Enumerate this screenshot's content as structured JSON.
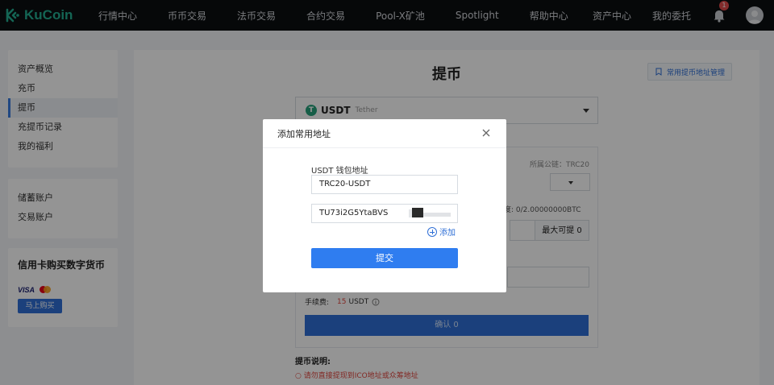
{
  "brand": {
    "name": "KuCoin",
    "color": "#23af91"
  },
  "nav": {
    "links": [
      "行情中心",
      "币币交易",
      "法币交易",
      "合约交易",
      "Pool-X矿池",
      "Spotlight",
      "帮助中心"
    ],
    "right": [
      "资产中心",
      "我的委托"
    ],
    "notification_count": "1"
  },
  "sidebar": {
    "group1": [
      "资产概览",
      "充币",
      "提币",
      "充提币记录",
      "我的福利"
    ],
    "active_item": "提币",
    "group2": [
      "储蓄账户",
      "交易账户"
    ],
    "card_buy": {
      "title": "信用卡购买数字货币",
      "visa": "VISA",
      "button": "马上购买"
    }
  },
  "main": {
    "title": "提币",
    "address_mgmt": "常用提币地址管理",
    "coin": {
      "symbol": "USDT",
      "name": "Tether",
      "icon_letter": "T"
    },
    "chain_label": "所属公链：TRC20",
    "limit": "度: 0/2.00000000BTC",
    "max_label": "最大可提 0",
    "fee_label": "手续费:",
    "fee_value": "15",
    "fee_unit": "USDT",
    "confirm": "确认 0",
    "notes_title": "提币说明:",
    "note_1": "请勿直接提现到ICO地址或众筹地址"
  },
  "modal": {
    "title": "添加常用地址",
    "field_label": "USDT 钱包地址",
    "chain_value": "TRC20-USDT",
    "address_value": "TU73i2G5YtaBVS",
    "add_label": "添加",
    "submit": "提交"
  },
  "colors": {
    "accent": "#2f7df0",
    "danger": "#e0463e",
    "navbar": "#0b0e11"
  }
}
